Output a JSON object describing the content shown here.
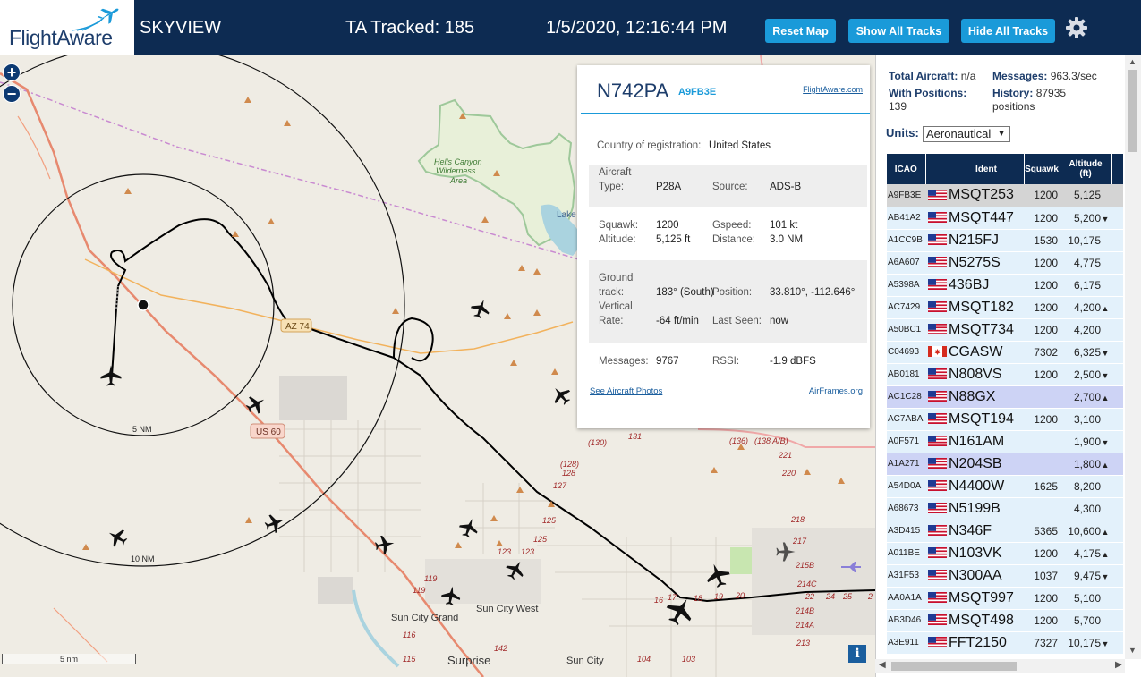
{
  "header": {
    "logo_flight": "Flight",
    "logo_aware": "Aware",
    "app_name": "SKYVIEW",
    "ta_tracked": "TA Tracked: 185",
    "datetime": "1/5/2020, 12:16:44 PM",
    "reset_map": "Reset Map",
    "show_all_tracks": "Show All Tracks",
    "hide_all_tracks": "Hide All Tracks"
  },
  "map": {
    "zoom_in": "+",
    "zoom_out": "−",
    "scale_label": "5 nm",
    "info": "i",
    "ring_5nm": "5 NM",
    "ring_10nm": "10 NM",
    "labels": {
      "hells_canyon_1": "Hells Canyon",
      "hells_canyon_2": "Wilderness",
      "hells_canyon_3": "Area",
      "lake": "Lake",
      "az74": "AZ 74",
      "us60": "US 60",
      "sun_city_grand": "Sun City Grand",
      "sun_city_west": "Sun City West",
      "surprise": "Surprise",
      "sun_city": "Sun City",
      "rt130": "(130)",
      "rt131": "131",
      "rt128": "(128)",
      "rt128b": "128",
      "rt127": "127",
      "rt125": "125",
      "rt125b": "125",
      "rt123": "123",
      "rt123b": "123",
      "rt119": "119",
      "rt119b": "119",
      "rt116": "116",
      "rt115": "115",
      "rt142": "142",
      "rt136": "(136)",
      "rt138": "(138 A/B)",
      "rt220": "220",
      "rt218": "218",
      "rt217": "217",
      "rt215b": "215B",
      "rt214c": "214C",
      "rt214b": "214B",
      "rt214a": "214A",
      "rt213": "213",
      "rt16": "16",
      "rt17": "17",
      "rt18": "18",
      "rt19": "19",
      "rt20": "20",
      "rt22": "22",
      "rt24": "24",
      "rt25": "25",
      "rt2": "2",
      "rt104": "104",
      "rt103": "103",
      "rt221": "221"
    }
  },
  "popup": {
    "callsign": "N742PA",
    "icao": "A9FB3E",
    "fa_link": "FlightAware.com",
    "country_label": "Country of registration:",
    "country_value": "United States",
    "aircraft_type_label_1": "Aircraft",
    "aircraft_type_label_2": "Type:",
    "aircraft_type_value": "P28A",
    "source_label": "Source:",
    "source_value": "ADS-B",
    "squawk_label": "Squawk:",
    "squawk_value": "1200",
    "gspeed_label": "Gspeed:",
    "gspeed_value": "101 kt",
    "altitude_label": "Altitude:",
    "altitude_value": "5,125 ft",
    "distance_label": "Distance:",
    "distance_value": "3.0 NM",
    "ground_label_1": "Ground",
    "ground_label_2": "track:",
    "ground_value": "183° (South)",
    "position_label": "Position:",
    "position_value": "33.810°, -112.646°",
    "vertical_label_1": "Vertical",
    "vertical_label_2": "Rate:",
    "vertical_value": "-64 ft/min",
    "last_seen_label": "Last Seen:",
    "last_seen_value": "now",
    "messages_label": "Messages:",
    "messages_value": "9767",
    "rssi_label": "RSSI:",
    "rssi_value": "-1.9 dBFS",
    "photos_link": "See Aircraft Photos",
    "airframes_link": "AirFrames.org"
  },
  "sidebar": {
    "total_aircraft_label": "Total Aircraft:",
    "total_aircraft_value": "n/a",
    "messages_label": "Messages:",
    "messages_value": "963.3/sec",
    "with_positions_label": "With Positions:",
    "with_positions_value": "139",
    "history_label": "History:",
    "history_value": "87935",
    "history_unit": "positions",
    "units_label": "Units:",
    "units_value": "Aeronautical",
    "columns": {
      "icao": "ICAO",
      "flag": "",
      "ident": "Ident",
      "squawk": "Squawk",
      "altitude_1": "Altitude",
      "altitude_2": "(ft)"
    },
    "rows": [
      {
        "icao": "A9FB3E",
        "flag": "us",
        "ident": "MSQT253",
        "squawk": "1200",
        "altitude": "5,125",
        "trend": ""
      },
      {
        "icao": "AB41A2",
        "flag": "us",
        "ident": "MSQT447",
        "squawk": "1200",
        "altitude": "5,200",
        "trend": "▼"
      },
      {
        "icao": "A1CC9B",
        "flag": "us",
        "ident": "N215FJ",
        "squawk": "1530",
        "altitude": "10,175",
        "trend": ""
      },
      {
        "icao": "A6A607",
        "flag": "us",
        "ident": "N5275S",
        "squawk": "1200",
        "altitude": "4,775",
        "trend": ""
      },
      {
        "icao": "A5398A",
        "flag": "us",
        "ident": "436BJ",
        "squawk": "1200",
        "altitude": "6,175",
        "trend": ""
      },
      {
        "icao": "AC7429",
        "flag": "us",
        "ident": "MSQT182",
        "squawk": "1200",
        "altitude": "4,200",
        "trend": "▲"
      },
      {
        "icao": "A50BC1",
        "flag": "us",
        "ident": "MSQT734",
        "squawk": "1200",
        "altitude": "4,200",
        "trend": ""
      },
      {
        "icao": "C04693",
        "flag": "ca",
        "ident": "CGASW",
        "squawk": "7302",
        "altitude": "6,325",
        "trend": "▼"
      },
      {
        "icao": "AB0181",
        "flag": "us",
        "ident": "N808VS",
        "squawk": "1200",
        "altitude": "2,500",
        "trend": "▼"
      },
      {
        "icao": "AC1C28",
        "flag": "us",
        "ident": "N88GX",
        "squawk": "",
        "altitude": "2,700",
        "trend": "▲"
      },
      {
        "icao": "AC7ABA",
        "flag": "us",
        "ident": "MSQT194",
        "squawk": "1200",
        "altitude": "3,100",
        "trend": ""
      },
      {
        "icao": "A0F571",
        "flag": "us",
        "ident": "N161AM",
        "squawk": "",
        "altitude": "1,900",
        "trend": "▼"
      },
      {
        "icao": "A1A271",
        "flag": "us",
        "ident": "N204SB",
        "squawk": "",
        "altitude": "1,800",
        "trend": "▲"
      },
      {
        "icao": "A54D0A",
        "flag": "us",
        "ident": "N4400W",
        "squawk": "1625",
        "altitude": "8,200",
        "trend": ""
      },
      {
        "icao": "A68673",
        "flag": "us",
        "ident": "N5199B",
        "squawk": "",
        "altitude": "4,300",
        "trend": ""
      },
      {
        "icao": "A3D415",
        "flag": "us",
        "ident": "N346F",
        "squawk": "5365",
        "altitude": "10,600",
        "trend": "▲"
      },
      {
        "icao": "A011BE",
        "flag": "us",
        "ident": "N103VK",
        "squawk": "1200",
        "altitude": "4,175",
        "trend": "▲"
      },
      {
        "icao": "A31F53",
        "flag": "us",
        "ident": "N300AA",
        "squawk": "1037",
        "altitude": "9,475",
        "trend": "▼"
      },
      {
        "icao": "AA0A1A",
        "flag": "us",
        "ident": "MSQT997",
        "squawk": "1200",
        "altitude": "5,100",
        "trend": ""
      },
      {
        "icao": "AB3D46",
        "flag": "us",
        "ident": "MSQT498",
        "squawk": "1200",
        "altitude": "5,700",
        "trend": ""
      },
      {
        "icao": "A3E911",
        "flag": "us",
        "ident": "FFT2150",
        "squawk": "7327",
        "altitude": "10,175",
        "trend": "▼"
      }
    ]
  },
  "colors": {
    "header_bg": "#0d2b52",
    "button_bg": "#1a9ad9",
    "row_bg": "#e3f1fb",
    "row_selected": "#d4d4d4",
    "row_highlight": "#cdd3f5",
    "map_bg": "#efece4",
    "track": "#000000",
    "us60_road": "#e7896f",
    "az74_road": "#f2b25c"
  },
  "icons": {
    "settings": "gear-icon",
    "logo": "flightaware-plane-icon",
    "aircraft": "airplane-icon"
  }
}
